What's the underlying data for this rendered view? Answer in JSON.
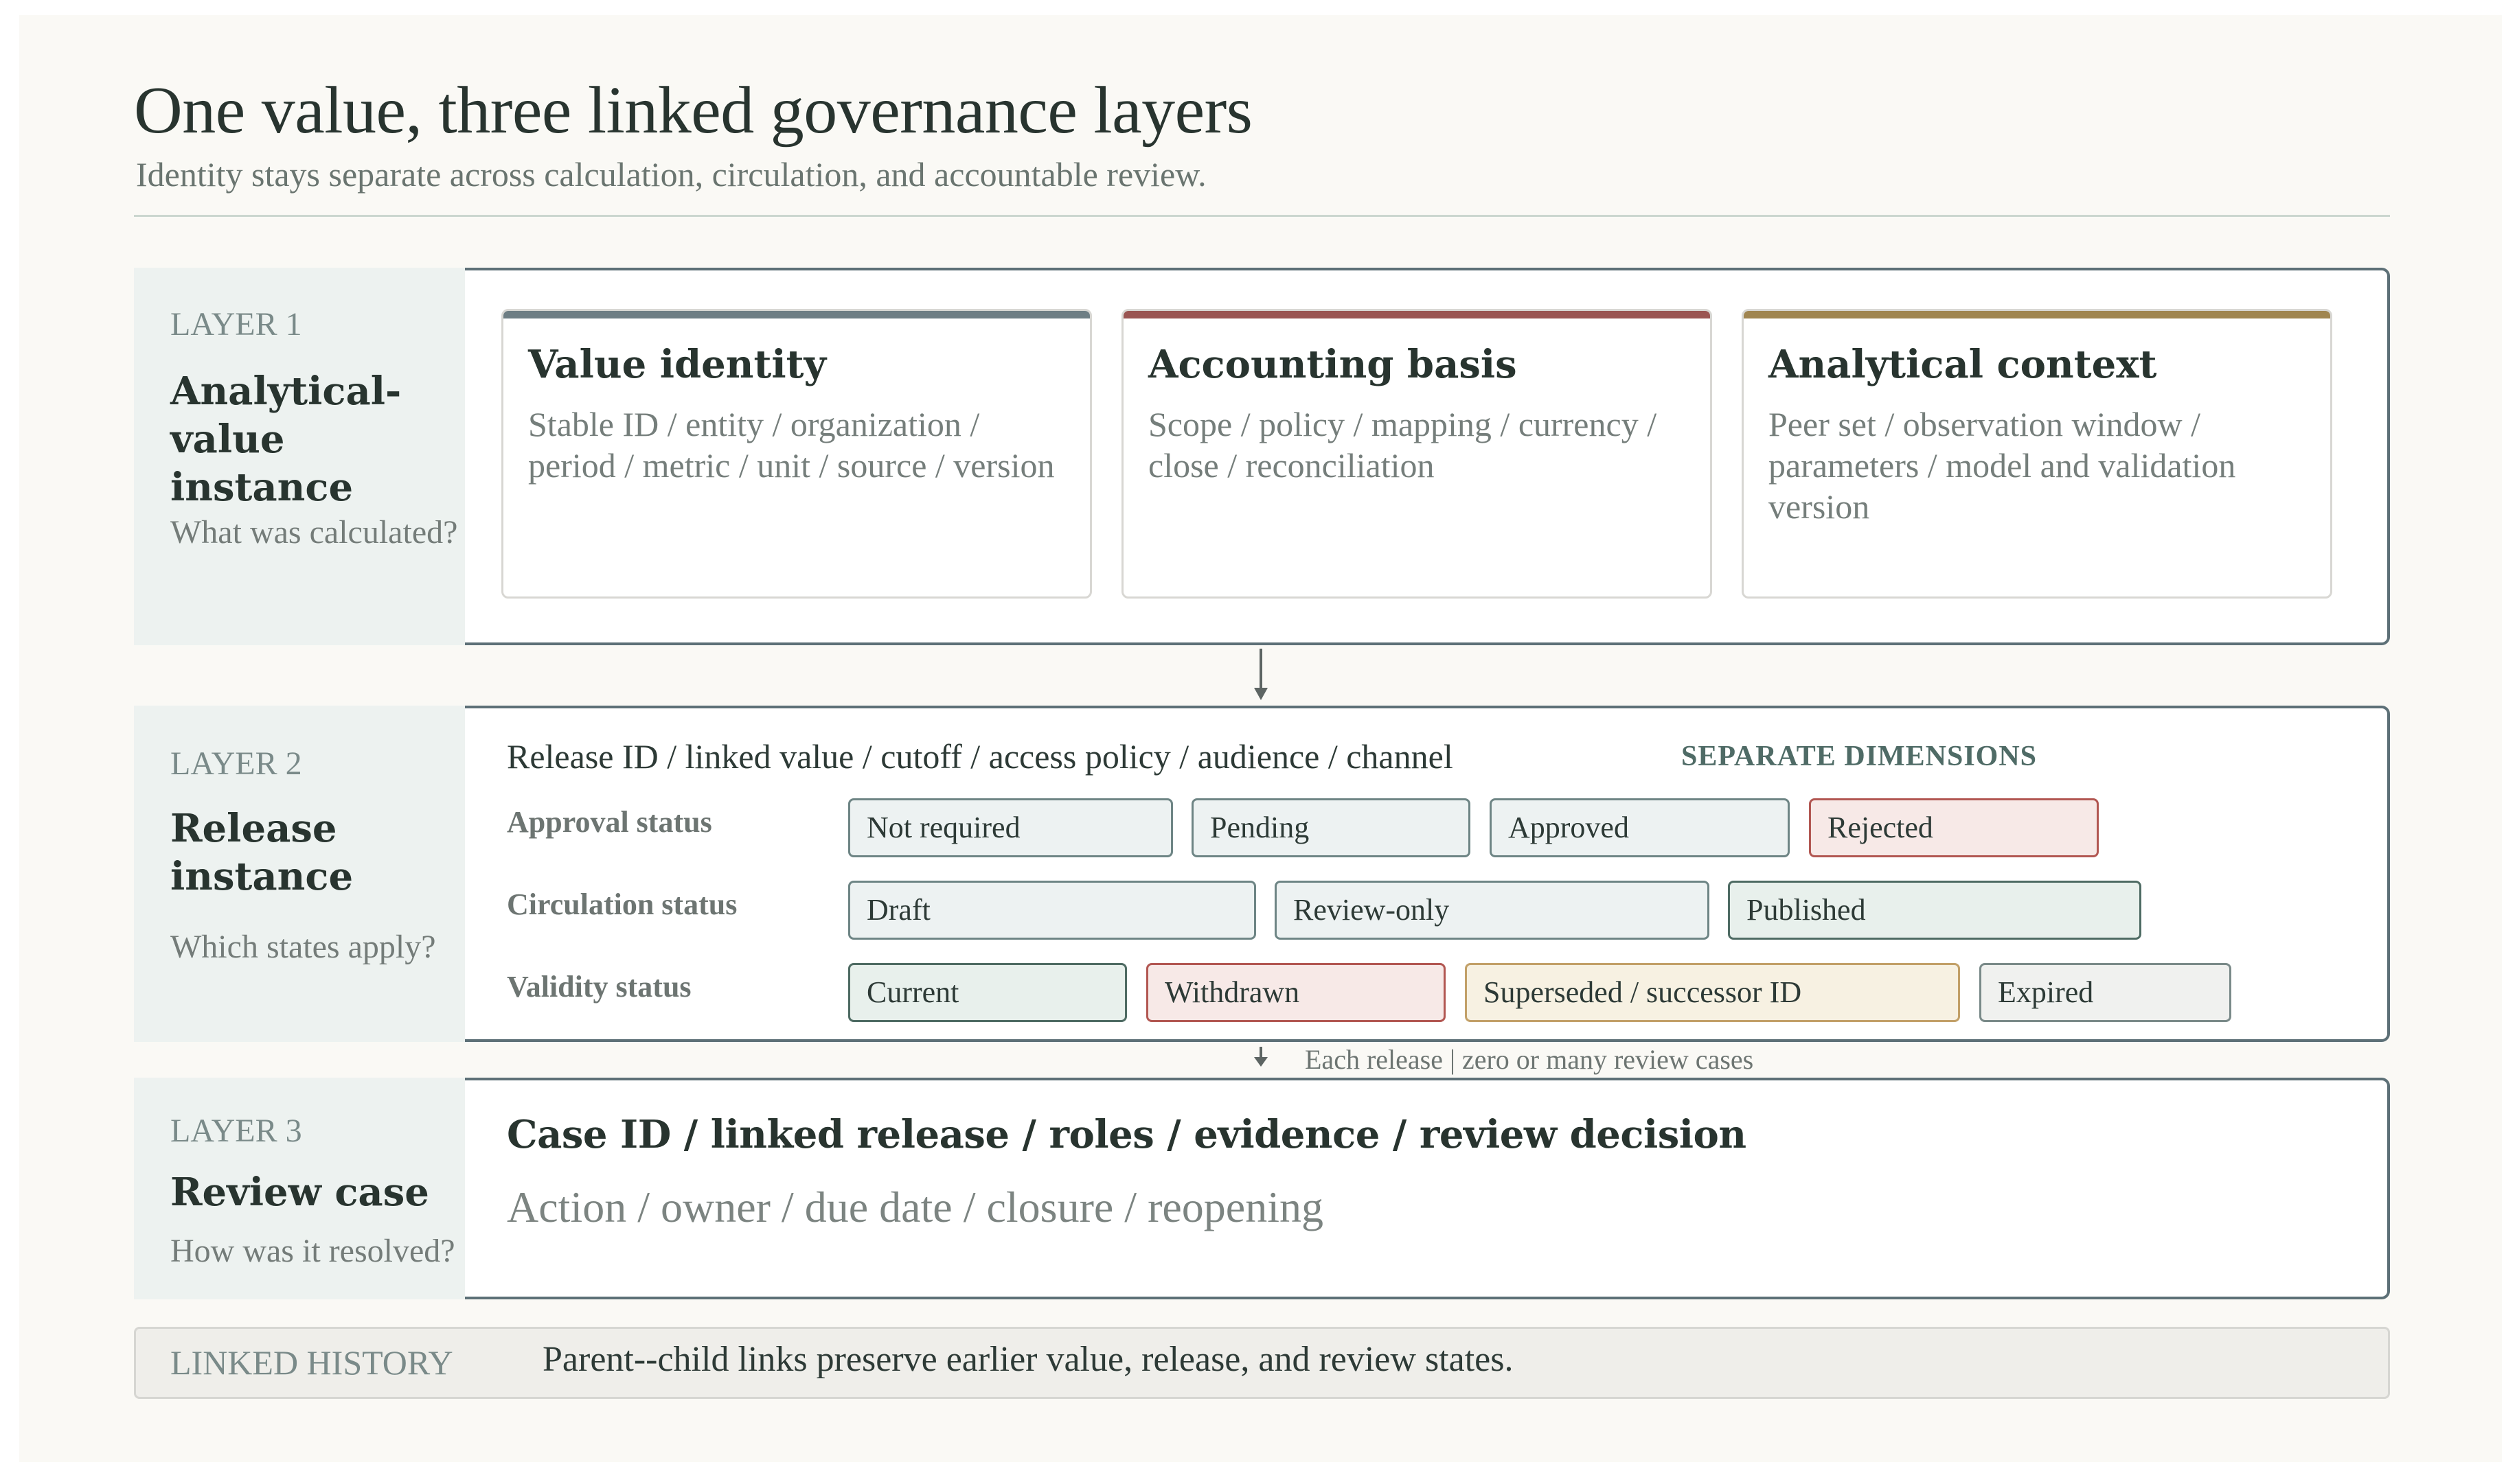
{
  "header": {
    "title": "One value, three linked governance layers",
    "subtitle": "Identity stays separate across calculation, circulation, and accountable review."
  },
  "layer1": {
    "tag": "LAYER 1",
    "name": "Analytical-value instance",
    "question": "What was calculated?",
    "cards": [
      {
        "title": "Value identity",
        "body": "Stable ID / entity / organization / period / metric / unit / source / version",
        "accent": "#6e7e84"
      },
      {
        "title": "Accounting basis",
        "body": "Scope / policy / mapping / currency / close / reconciliation",
        "accent": "#9a5552"
      },
      {
        "title": "Analytical context",
        "body": "Peer set / observation window / parameters / model and validation version",
        "accent": "#a08550"
      }
    ]
  },
  "layer2": {
    "tag": "LAYER 2",
    "name": "Release instance",
    "question": "Which states apply?",
    "fields": "Release ID / linked value / cutoff / access policy / audience / channel",
    "separate_label": "SEPARATE DIMENSIONS",
    "approval": {
      "label": "Approval status",
      "options": [
        "Not required",
        "Pending",
        "Approved",
        "Rejected"
      ]
    },
    "circulation": {
      "label": "Circulation status",
      "options": [
        "Draft",
        "Review-only",
        "Published"
      ]
    },
    "validity": {
      "label": "Validity status",
      "options": [
        "Current",
        "Withdrawn",
        "Superseded / successor ID",
        "Expired"
      ]
    }
  },
  "connector": {
    "label": "Each release | zero or many review cases"
  },
  "layer3": {
    "tag": "LAYER 3",
    "name": "Review case",
    "question": "How was it resolved?",
    "fields": "Case ID / linked release / roles / evidence / review decision",
    "actions": "Action / owner / due date / closure / reopening"
  },
  "history": {
    "tag": "LINKED HISTORY",
    "text": "Parent--child links preserve earlier value, release, and review states."
  },
  "colors": {
    "frame": "#5d7077",
    "side_panel": "#edf2f0",
    "reject_red": "#b25752",
    "superseded_gold": "#c2a068"
  }
}
